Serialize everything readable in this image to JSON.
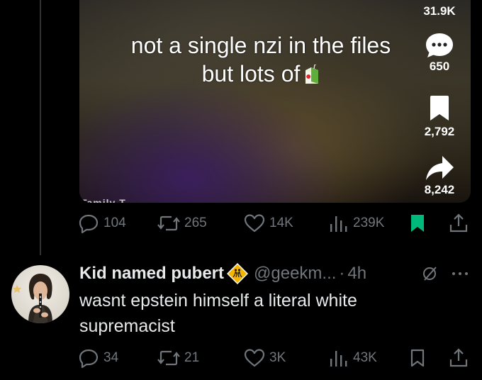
{
  "video": {
    "caption_line1": "not a single nzi in the files",
    "caption_line2": "but lots of",
    "caption_icon": "juice-box-icon",
    "watermark": "Tamily T",
    "rail": {
      "likes": "31.9K",
      "comments": "650",
      "saves": "2,792",
      "shares": "8,242"
    }
  },
  "post_actions": {
    "replies": "104",
    "reposts": "265",
    "likes": "14K",
    "views": "239K",
    "bookmarked": true
  },
  "reply": {
    "name": "Kid named pubert",
    "handle": "@geekm...",
    "separator": "·",
    "time": "4h",
    "text": "wasnt epstein himself a literal white supremacist",
    "actions": {
      "replies": "34",
      "reposts": "21",
      "likes": "3K",
      "views": "43K",
      "bookmarked": false
    }
  },
  "colors": {
    "background": "#000000",
    "muted": "#71767b",
    "text": "#e7e9ea",
    "bookmark_active": "#00ba7c",
    "badge": "#f5b400"
  }
}
